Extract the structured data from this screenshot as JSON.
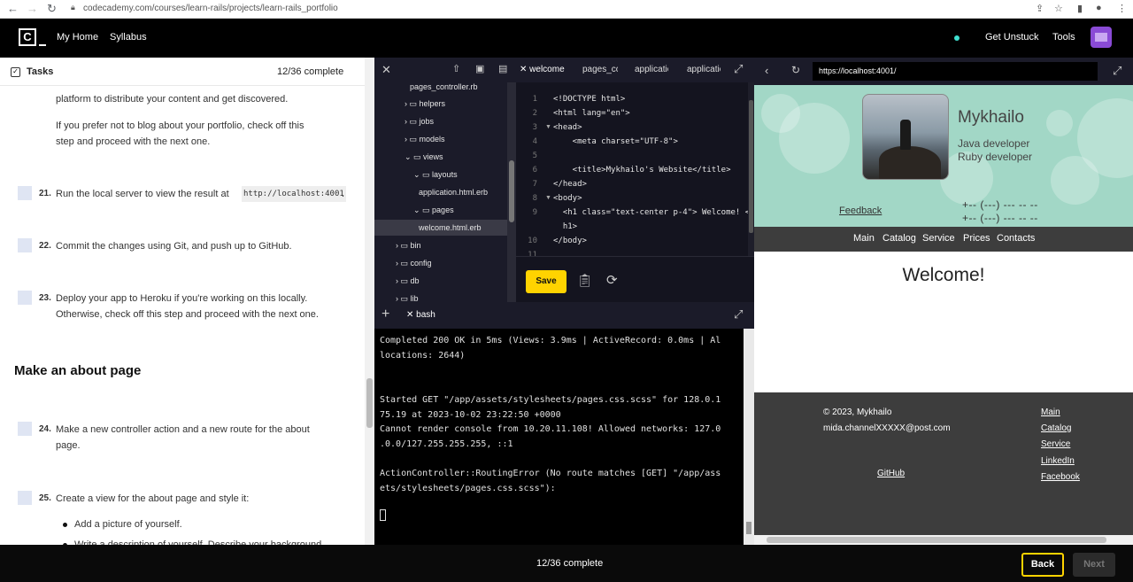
{
  "browser": {
    "url": "codecademy.com/courses/learn-rails/projects/learn-rails_portfolio"
  },
  "topnav": {
    "logo": "C",
    "links": [
      "My Home",
      "Syllabus"
    ],
    "right_links": [
      "Get Unstuck",
      "Tools"
    ]
  },
  "tasks": {
    "label": "Tasks",
    "count": "12/36 complete",
    "paragraphs": [
      "platform to distribute your content and get discovered.",
      "If you prefer not to blog about your portfolio, check off this",
      "step and proceed with the next one."
    ],
    "items": [
      {
        "num": "21.",
        "text": "Run the local server to view the result at",
        "code": "http://localhost:4001",
        "suffix": "."
      },
      {
        "num": "22.",
        "text": "Commit the changes using Git, and push up to GitHub."
      },
      {
        "num": "23.",
        "line1": "Deploy your app to Heroku if you're working on this locally.",
        "line2": "Otherwise, check off this step and proceed with the next one."
      },
      {
        "num": "24.",
        "line1": "Make a new controller action and a new route for the about",
        "line2": "page."
      },
      {
        "num": "25.",
        "text": "Create a view for the about page and style it:"
      }
    ],
    "section_title": "Make an about page",
    "bullets": [
      "Add a picture of yourself.",
      "Write a description of yourself. Describe your background"
    ]
  },
  "editor": {
    "tabs": [
      "welcome",
      "pages_cc",
      "applicatio",
      "applicatio"
    ],
    "tree": {
      "top": "pages_controller.rb",
      "items": [
        "helpers",
        "jobs",
        "models",
        "views",
        "layouts",
        "application.html.erb",
        "pages",
        "welcome.html.erb",
        "bin",
        "config",
        "db",
        "lib"
      ]
    },
    "line_numbers": [
      "1",
      "2",
      "3",
      "4",
      "5",
      "6",
      "7",
      "8",
      "9",
      "",
      "10",
      "11"
    ],
    "code_lines": [
      "<!DOCTYPE html>",
      "<html lang=\"en\">",
      "<head>",
      "    <meta charset=\"UTF-8\">",
      "",
      "    <title>Mykhailo's Website</title>",
      "</head>",
      "<body>",
      "  <h1 class=\"text-center p-4\"> Welcome! </",
      "  h1>",
      "</body>",
      ""
    ],
    "save_label": "Save"
  },
  "terminal": {
    "tab": "bash",
    "lines": [
      "Completed 200 OK in 5ms (Views: 3.9ms | ActiveRecord: 0.0ms | Al",
      "locations: 2644)",
      "",
      "",
      "Started GET \"/app/assets/stylesheets/pages.css.scss\" for 128.0.1",
      "75.19 at 2023-10-02 23:22:50 +0000",
      "Cannot render console from 10.20.11.108! Allowed networks: 127.0",
      ".0.0/127.255.255.255, ::1",
      "",
      "ActionController::RoutingError (No route matches [GET] \"/app/ass",
      "ets/stylesheets/pages.css.scss\"):"
    ]
  },
  "preview": {
    "url": "https://localhost:4001/",
    "name": "Mykhailo",
    "roles": [
      "Java developer",
      "Ruby developer"
    ],
    "feedback": "Feedback",
    "phones": [
      "+-- (---) --- -- --",
      "+-- (---) --- -- --"
    ],
    "nav": [
      "Main",
      "Catalog",
      "Service",
      "Prices",
      "Contacts"
    ],
    "welcome": "Welcome!",
    "footer": {
      "copyright": "© 2023, Mykhailo",
      "email": "mida.channelXXXXX@post.com",
      "github": "GitHub",
      "links": [
        "Main",
        "Catalog",
        "Service",
        "LinkedIn",
        "Facebook"
      ]
    }
  },
  "bottom": {
    "count": "12/36 complete",
    "back": "Back",
    "next": "Next"
  },
  "colors": {
    "accent": "#ffd300",
    "hero": "#a2d7c6",
    "dark": "#3d3d3d"
  }
}
